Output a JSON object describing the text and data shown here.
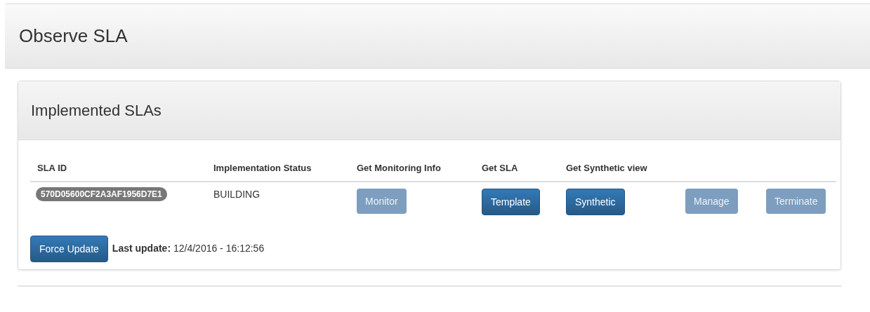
{
  "page": {
    "title": "Observe SLA"
  },
  "panel": {
    "title": "Implemented SLAs",
    "table": {
      "columns": [
        "SLA ID",
        "Implementation Status",
        "Get Monitoring Info",
        "Get SLA",
        "Get Synthetic view"
      ],
      "rows": [
        {
          "sla_id": "570D05600CF2A3AF1956D7E1",
          "status": "BUILDING",
          "actions": [
            {
              "label": "Monitor",
              "disabled": true
            },
            {
              "label": "Template",
              "disabled": false
            },
            {
              "label": "Synthetic",
              "disabled": false
            },
            {
              "label": "Manage",
              "disabled": true
            },
            {
              "label": "Terminate",
              "disabled": true
            }
          ]
        }
      ]
    },
    "footer": {
      "button": "Force Update",
      "last_update": "**Last update:** 12/4/2016 - 16:12:56"
    }
  }
}
